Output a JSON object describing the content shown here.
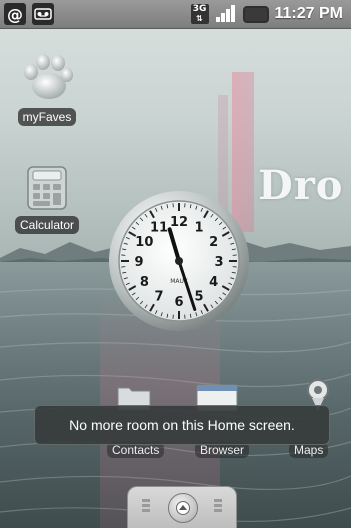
{
  "status_bar": {
    "time": "11:27 PM",
    "network_type": "3G",
    "notification_icons": [
      "at-sign-icon",
      "voicemail-icon"
    ]
  },
  "desktop": {
    "shortcuts": [
      {
        "label": "myFaves",
        "icon": "paw-icon"
      },
      {
        "label": "Calculator",
        "icon": "calculator-icon"
      }
    ],
    "wallpaper_text": "Dro"
  },
  "clock_widget": {
    "brand": "MAUK",
    "numerals": [
      "12",
      "1",
      "2",
      "3",
      "4",
      "5",
      "6",
      "7",
      "8",
      "9",
      "10",
      "11"
    ],
    "time_shown": "11:27"
  },
  "dock": {
    "items": [
      {
        "label": "Contacts",
        "icon": "folder-icon"
      },
      {
        "label": "Browser",
        "icon": "browser-window-icon"
      },
      {
        "label": "Maps",
        "icon": "map-pin-icon"
      }
    ]
  },
  "toast": {
    "message": "No more room on this Home screen."
  },
  "colors": {
    "status_bar": "#8c8c8c",
    "toast_bg": "#373c3c",
    "wallpaper_pink": "#d7788f"
  }
}
